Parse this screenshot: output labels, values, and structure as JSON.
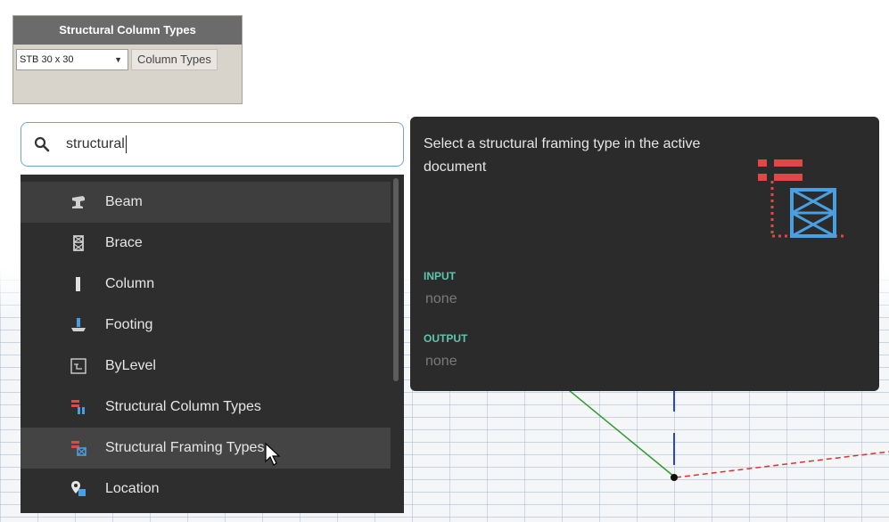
{
  "node": {
    "title": "Structural Column Types",
    "selected_value": "STB 30 x 30",
    "output_port": "Column Types"
  },
  "search": {
    "value": "structural"
  },
  "results": {
    "items": [
      {
        "label": "Beam",
        "icon": "beam-icon"
      },
      {
        "label": "Brace",
        "icon": "brace-icon"
      },
      {
        "label": "Column",
        "icon": "column-icon"
      },
      {
        "label": "Footing",
        "icon": "footing-icon"
      },
      {
        "label": "ByLevel",
        "icon": "by-level-icon"
      },
      {
        "label": "Structural Column Types",
        "icon": "structural-column-types-icon"
      },
      {
        "label": "Structural Framing Types",
        "icon": "structural-framing-types-icon"
      },
      {
        "label": "Location",
        "icon": "location-icon"
      }
    ]
  },
  "tooltip": {
    "description": "Select a structural framing type in the active document",
    "input_label": "INPUT",
    "input_value": "none",
    "output_label": "OUTPUT",
    "output_value": "none"
  },
  "colors": {
    "accent_blue": "#4a9fe0",
    "accent_red": "#e04848",
    "port_label_teal": "#5cc7b0"
  }
}
